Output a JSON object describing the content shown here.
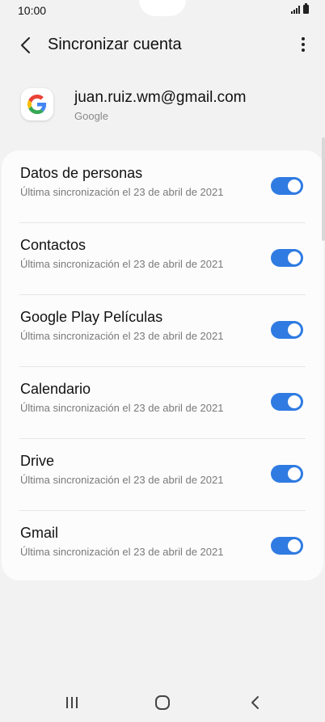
{
  "status_bar": {
    "time": "10:00"
  },
  "header": {
    "title": "Sincronizar cuenta",
    "back_icon": "chevron-left-icon",
    "more_icon": "more-vertical-icon"
  },
  "account": {
    "icon": "google-logo-icon",
    "email": "juan.ruiz.wm@gmail.com",
    "type": "Google"
  },
  "sync_items": [
    {
      "title": "Datos de personas",
      "subtitle": "Última sincronización el 23 de abril de 2021",
      "enabled": true
    },
    {
      "title": "Contactos",
      "subtitle": "Última sincronización el 23 de abril de 2021",
      "enabled": true
    },
    {
      "title": "Google Play Películas",
      "subtitle": "Última sincronización el 23 de abril de 2021",
      "enabled": true
    },
    {
      "title": "Calendario",
      "subtitle": "Última sincronización el 23 de abril de 2021",
      "enabled": true
    },
    {
      "title": "Drive",
      "subtitle": "Última sincronización el 23 de abril de 2021",
      "enabled": true
    },
    {
      "title": "Gmail",
      "subtitle": "Última sincronización el 23 de abril de 2021",
      "enabled": true
    }
  ],
  "colors": {
    "accent": "#2f7be2",
    "background": "#f2f2f2",
    "card": "#fcfcfc"
  },
  "nav_bar": {
    "recents_icon": "recents-icon",
    "home_icon": "home-icon",
    "back_icon": "back-icon"
  }
}
